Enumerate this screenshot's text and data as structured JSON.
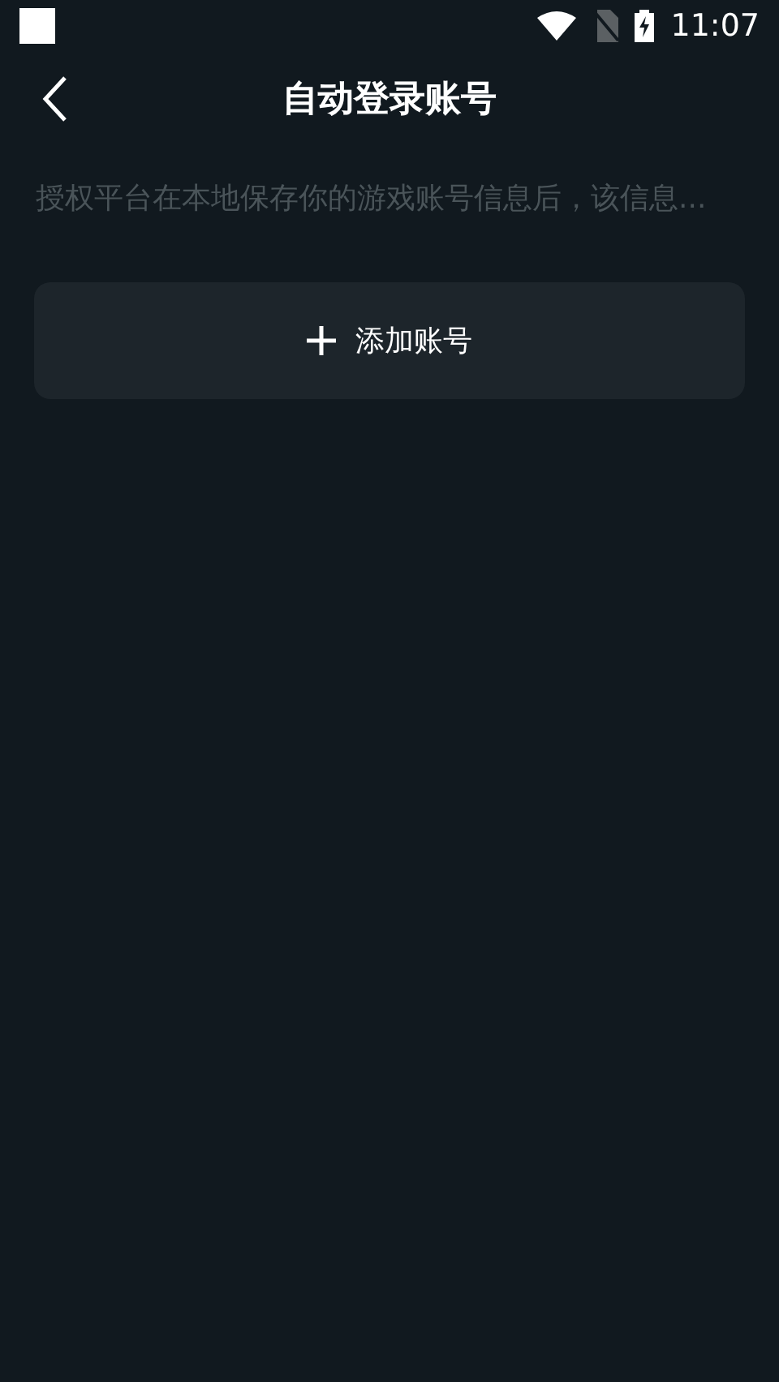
{
  "status_bar": {
    "time": "11:07"
  },
  "header": {
    "title": "自动登录账号"
  },
  "description": "授权平台在本地保存你的游戏账号信息后，该信息...",
  "add_button": {
    "label": "添加账号"
  }
}
